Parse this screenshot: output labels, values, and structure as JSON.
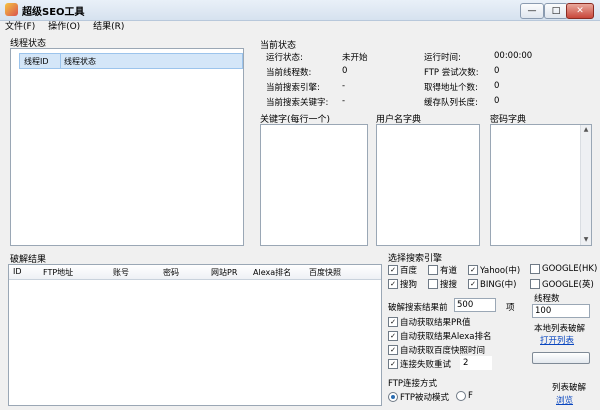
{
  "window": {
    "title": "超级SEO工具",
    "minimize": "—",
    "maximize": "□",
    "close": "✕"
  },
  "menu": [
    "文件(F)",
    "操作(O)",
    "结果(R)"
  ],
  "thread_status": {
    "label": "线程状态",
    "columns": [
      "线程ID",
      "线程状态"
    ]
  },
  "current_status": {
    "label": "当前状态",
    "rows_left": [
      {
        "label": "运行状态:",
        "value": "未开始"
      },
      {
        "label": "当前线程数:",
        "value": "0"
      },
      {
        "label": "当前搜索引擎:",
        "value": "-"
      },
      {
        "label": "当前搜索关键字:",
        "value": "-"
      }
    ],
    "rows_right": [
      {
        "label": "运行时间:",
        "value": "00:00:00"
      },
      {
        "label": "FTP 尝试次数:",
        "value": "0"
      },
      {
        "label": "取得地址个数:",
        "value": "0"
      },
      {
        "label": "缓存队列长度:",
        "value": "0"
      }
    ]
  },
  "dicts": {
    "keywords": "关键字(每行一个)",
    "usernames": "用户名字典",
    "passwords": "密码字典"
  },
  "results": {
    "label": "破解结果",
    "columns": [
      "ID",
      "FTP地址",
      "账号",
      "密码",
      "网站PR",
      "Alexa排名",
      "百度快照"
    ]
  },
  "engines": {
    "label": "选择搜索引擎",
    "items": [
      {
        "label": "百度",
        "checked": true
      },
      {
        "label": "有道",
        "checked": false
      },
      {
        "label": "Yahoo(中)",
        "checked": true
      },
      {
        "label": "GOOGLE(HK)",
        "checked": false
      },
      {
        "label": "搜狗",
        "checked": true
      },
      {
        "label": "搜搜",
        "checked": false
      },
      {
        "label": "BING(中)",
        "checked": true
      },
      {
        "label": "GOOGLE(英)",
        "checked": false
      }
    ]
  },
  "crack_options": {
    "prefix": "破解搜索结果前",
    "count": "500",
    "suffix": "项",
    "auto_pr": "自动获取结果PR值",
    "auto_alexa": "自动获取结果Alexa排名",
    "auto_baidu": "自动获取百度快照时间",
    "retry_label": "连接失败重试",
    "retry_count": "2"
  },
  "threads": {
    "label": "线程数",
    "value": "100"
  },
  "local_list": {
    "label": "本地列表破解",
    "link": "打开列表"
  },
  "ftp_mode": {
    "label": "FTP连接方式",
    "passive": "FTP被动模式",
    "active": "F"
  },
  "list_crack": {
    "label": "列表破解",
    "link": "浏览"
  }
}
